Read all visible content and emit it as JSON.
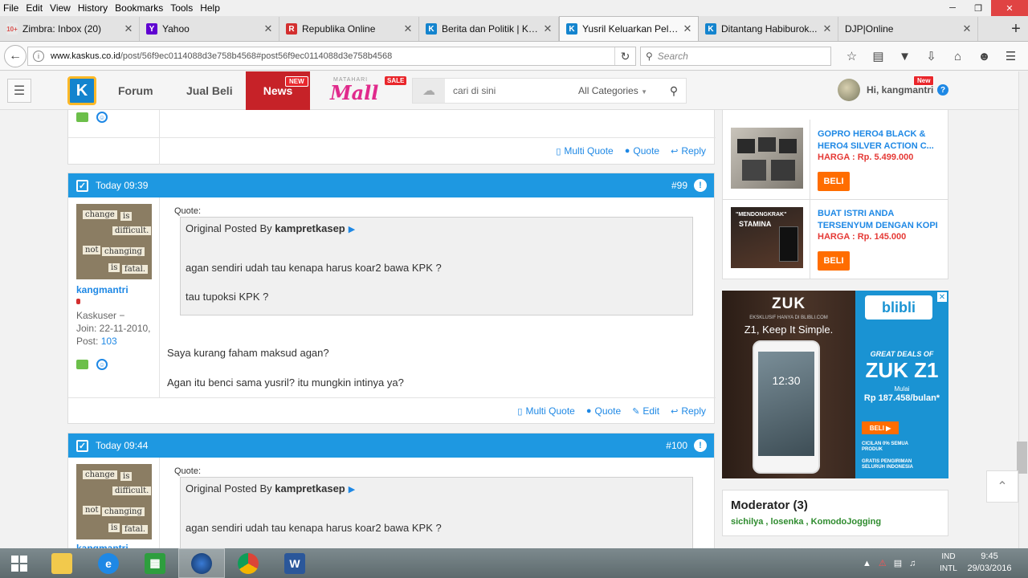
{
  "menubar": [
    "File",
    "Edit",
    "View",
    "History",
    "Bookmarks",
    "Tools",
    "Help"
  ],
  "tabs": [
    {
      "title": "Zimbra: Inbox (20)",
      "icon": "zimbra-icon",
      "color": "#d9534f",
      "glyph": "10"
    },
    {
      "title": "Yahoo",
      "icon": "yahoo-icon",
      "color": "#5f01d1",
      "glyph": "Y"
    },
    {
      "title": "Republika Online",
      "icon": "republika-icon",
      "color": "#d32f2f",
      "glyph": "R"
    },
    {
      "title": "Berita dan Politik | KA...",
      "icon": "kaskus-icon",
      "color": "#1484ce",
      "glyph": "K"
    },
    {
      "title": "Yusril Keluarkan Pelor...",
      "icon": "kaskus-icon",
      "color": "#1484ce",
      "glyph": "K",
      "active": true
    },
    {
      "title": "Ditantang Habiburok...",
      "icon": "kaskus-icon",
      "color": "#1484ce",
      "glyph": "K"
    },
    {
      "title": "DJP|Online",
      "icon": "blank-icon",
      "color": "#ffffff",
      "glyph": ""
    }
  ],
  "url": {
    "host": "www.kaskus.co.id",
    "path": "/post/56f9ec0114088d3e758b4568#post56f9ec0114088d3e758b4568"
  },
  "search_placeholder": "Search",
  "site": {
    "nav": [
      "Forum",
      "Jual Beli"
    ],
    "news": "News",
    "news_badge": "NEW",
    "mall_top": "MATAHARI",
    "mall": "Mall",
    "mall_sale": "SALE",
    "search_placeholder": "cari di sini",
    "categories": "All Categories",
    "greeting": "Hi, kangmantri",
    "user_badge": "New"
  },
  "posts": [
    {
      "time": "Today 09:39",
      "number": "#99",
      "username": "kangmantri",
      "rank": "Kaskuser",
      "join": "Join: 22-11-2010,",
      "post_label": "Post:",
      "post_count": "103",
      "quote_label": "Quote:",
      "quote_by": "Original Posted By",
      "quote_author": "kampretkasep",
      "quote_lines": [
        "agan sendiri udah tau kenapa harus koar2 bawa KPK ?",
        "tau tupoksi KPK ?"
      ],
      "body": [
        "Saya kurang faham maksud agan?",
        "Agan itu benci sama yusril? itu mungkin intinya ya?"
      ],
      "actions": [
        "Multi Quote",
        "Quote",
        "Edit",
        "Reply"
      ]
    },
    {
      "time": "Today 09:44",
      "number": "#100",
      "username": "kangmantri",
      "quote_label": "Quote:",
      "quote_by": "Original Posted By",
      "quote_author": "kampretkasep",
      "quote_lines": [
        "agan sendiri udah tau kenapa harus koar2 bawa KPK ?"
      ]
    }
  ],
  "prev_actions": [
    "Multi Quote",
    "Quote",
    "Reply"
  ],
  "avatar_words": [
    "change",
    "is",
    "difficult.",
    "not",
    "changing",
    "is",
    "fatal."
  ],
  "products": [
    {
      "title": "GOPRO HERO4 BLACK & HERO4 SILVER ACTION C...",
      "price": "HARGA : Rp. 5.499.000",
      "button": "BELI"
    },
    {
      "title": "BUAT ISTRI ANDA TERSENYUM DENGAN KOPI",
      "price": "HARGA : Rp. 145.000",
      "button": "BELI"
    }
  ],
  "ad": {
    "brand": "ZUK",
    "exclusive": "EKSKLUSIF HANYA DI BLIBLI.COM",
    "slogan": "Z1, Keep It Simple.",
    "clock": "12:30",
    "store": "blibli",
    "deals": "GREAT DEALS OF",
    "model": "ZUK Z1",
    "mulai": "Mulai",
    "price": "Rp 187.458/bulan*",
    "button": "BELI",
    "feature1": "CICILAN 0% SEMUA PRODUK",
    "feature2": "GRATIS PENGIRIMAN SELURUH INDONESIA"
  },
  "moderator": {
    "title": "Moderator (3)",
    "list": "sichilya , losenka , KomodoJogging"
  },
  "taskbar": {
    "lang_top": "IND",
    "lang_bottom": "INTL",
    "time": "9:45",
    "date": "29/03/2016"
  }
}
